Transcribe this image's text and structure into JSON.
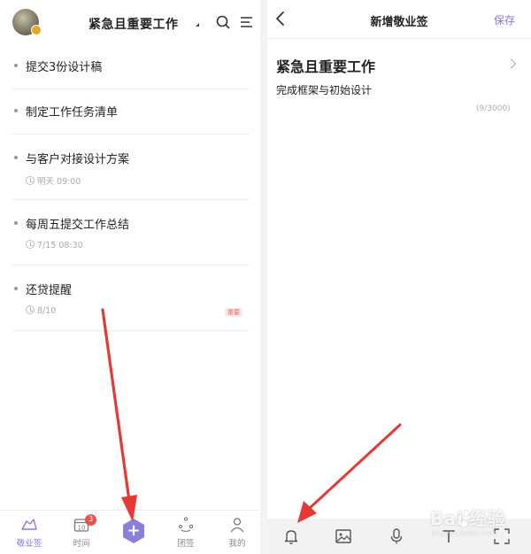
{
  "left": {
    "header": {
      "title": "紧急且重要工作"
    },
    "tasks": [
      {
        "label": "提交3份设计稿"
      },
      {
        "label": "制定工作任务清单"
      },
      {
        "label": "与客户对接设计方案",
        "reminder": "明天 09:00"
      },
      {
        "label": "每周五提交工作总结",
        "reminder": "7/15 08:30"
      },
      {
        "label": "还贷提醒",
        "reminder": "8/10",
        "tag": "重要"
      }
    ],
    "nav": {
      "notes": "敬业签",
      "time": "时间",
      "time_badge": "3",
      "time_day": "10",
      "add": "+",
      "team": "团签",
      "mine": "我的"
    },
    "accent_color": "#8878d8"
  },
  "right": {
    "header": {
      "title": "新增敬业签",
      "save": "保存"
    },
    "note": {
      "title": "紧急且重要工作",
      "body": "完成框架与初始设计",
      "count": "(9/3000)"
    },
    "toolbar": [
      "bell-icon",
      "image-icon",
      "mic-icon",
      "text-icon",
      "fullscreen-icon"
    ]
  },
  "watermark": {
    "text": "Bai 经验",
    "sub": "jingyan.baidu.com"
  }
}
